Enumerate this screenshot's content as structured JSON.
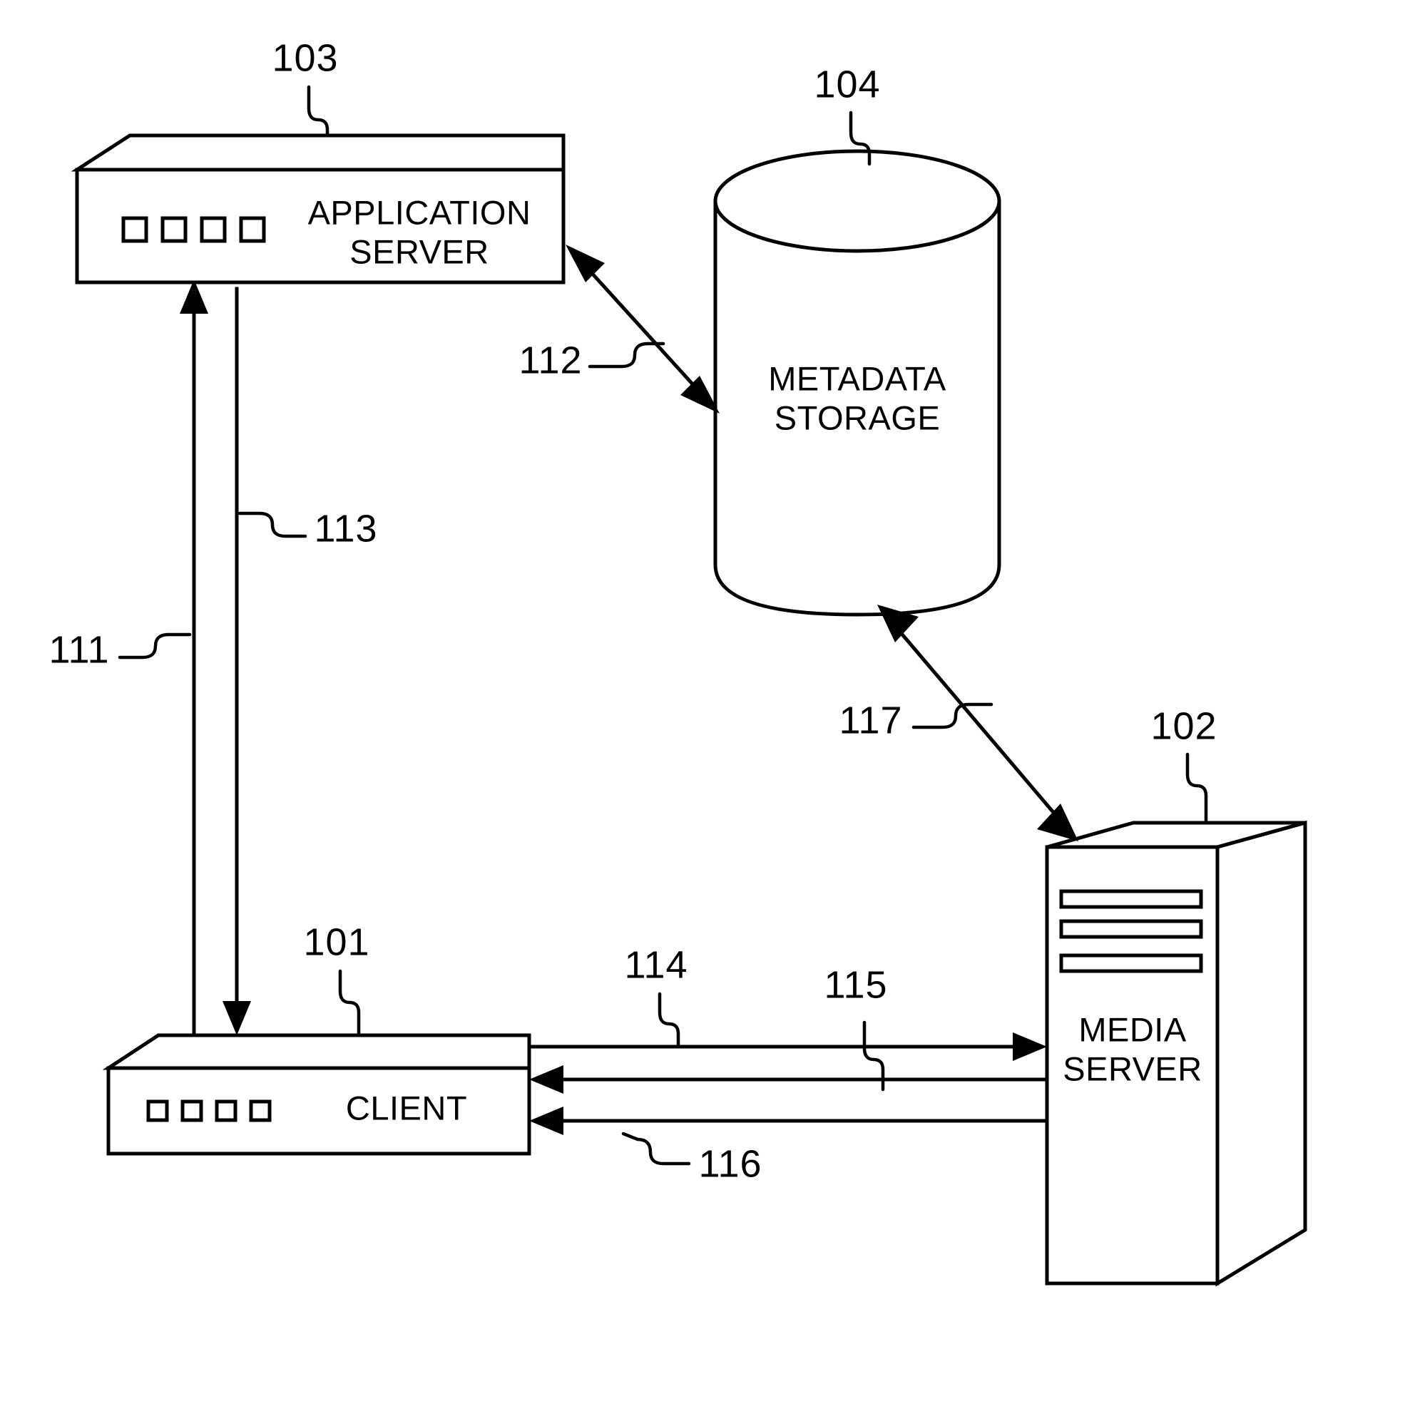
{
  "figure": {
    "title": "",
    "background_color": "#ffffff",
    "line_color": "#000000"
  },
  "nodes": {
    "application_server": {
      "ref": "103",
      "label_line1": "APPLICATION",
      "label_line2": "SERVER",
      "shape": "rack-box-3d",
      "port_count": 4
    },
    "metadata_storage": {
      "ref": "104",
      "label_line1": "METADATA",
      "label_line2": "STORAGE",
      "shape": "cylinder"
    },
    "client": {
      "ref": "101",
      "label_line1": "CLIENT",
      "label_line2": "",
      "shape": "rack-box-3d",
      "port_count": 4
    },
    "media_server": {
      "ref": "102",
      "label_line1": "MEDIA",
      "label_line2": "SERVER",
      "shape": "tower-3d",
      "slot_count": 3
    }
  },
  "connections": [
    {
      "ref": "111",
      "name": "client-to-application-server",
      "direction": "up",
      "style": "single-arrow"
    },
    {
      "ref": "113",
      "name": "application-server-to-client",
      "direction": "down",
      "style": "single-arrow"
    },
    {
      "ref": "112",
      "name": "application-server-metadata-storage",
      "direction": "bidirectional",
      "style": "double-arrow"
    },
    {
      "ref": "117",
      "name": "metadata-storage-media-server",
      "direction": "bidirectional",
      "style": "double-arrow"
    },
    {
      "ref": "114",
      "name": "client-to-media-server",
      "direction": "right",
      "style": "single-arrow"
    },
    {
      "ref": "115",
      "name": "media-server-to-client-upper",
      "direction": "left",
      "style": "single-arrow"
    },
    {
      "ref": "116",
      "name": "media-server-to-client-lower",
      "direction": "left",
      "style": "single-arrow"
    }
  ]
}
